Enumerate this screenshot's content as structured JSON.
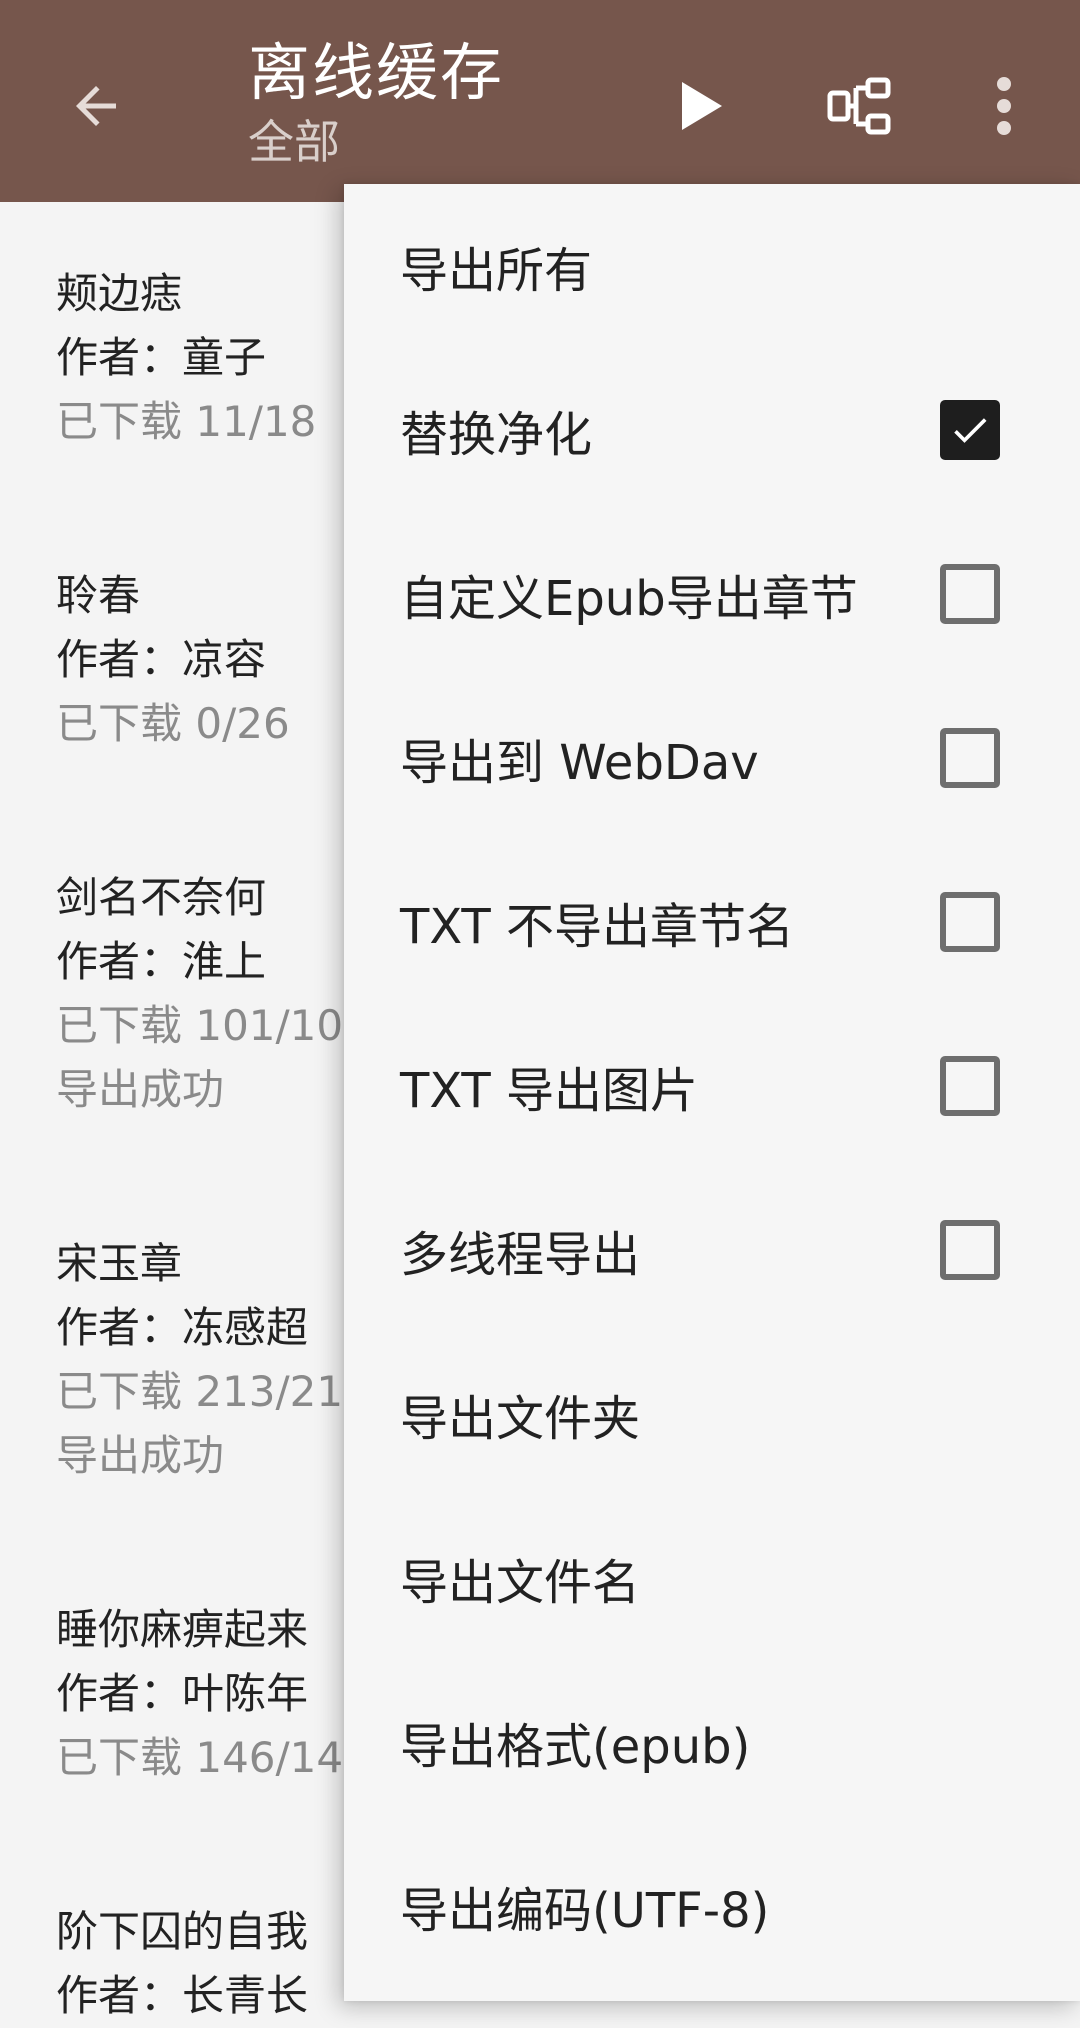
{
  "header": {
    "title": "离线缓存",
    "subtitle": "全部",
    "back_icon": "arrow-left-icon",
    "play_icon": "play-icon",
    "group_icon": "group-icon",
    "more_icon": "more-vertical-icon",
    "background_color": "#76564c"
  },
  "books": [
    {
      "title": "颊边痣",
      "author": "作者：童子",
      "progress": "已下载 11/18",
      "status": ""
    },
    {
      "title": "聆春",
      "author": "作者：凉容",
      "progress": "已下载 0/26",
      "status": ""
    },
    {
      "title": "剑名不奈何",
      "author": "作者：淮上",
      "progress": "已下载 101/10",
      "status": "导出成功"
    },
    {
      "title": "宋玉章",
      "author": "作者：冻感超",
      "progress": "已下载 213/21",
      "status": "导出成功"
    },
    {
      "title": "睡你麻痹起来",
      "author": "作者：叶陈年",
      "progress": "已下载 146/14",
      "status": ""
    },
    {
      "title": "阶下囚的自我",
      "author": "作者：长青长",
      "progress": "",
      "status": ""
    }
  ],
  "menu": {
    "items": [
      {
        "label": "导出所有",
        "checkbox": null
      },
      {
        "label": "替换净化",
        "checkbox": true
      },
      {
        "label": "自定义Epub导出章节",
        "checkbox": false
      },
      {
        "label": "导出到 WebDav",
        "checkbox": false
      },
      {
        "label": "TXT 不导出章节名",
        "checkbox": false
      },
      {
        "label": "TXT 导出图片",
        "checkbox": false
      },
      {
        "label": "多线程导出",
        "checkbox": false
      },
      {
        "label": "导出文件夹",
        "checkbox": null
      },
      {
        "label": "导出文件名",
        "checkbox": null
      },
      {
        "label": "导出格式(epub)",
        "checkbox": null
      },
      {
        "label": "导出编码(UTF-8)",
        "checkbox": null
      }
    ]
  }
}
